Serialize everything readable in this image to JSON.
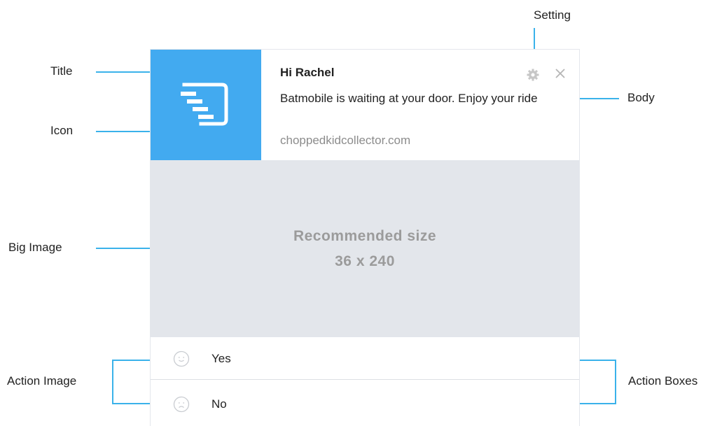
{
  "callouts": {
    "setting": "Setting",
    "title": "Title",
    "body": "Body",
    "icon": "Icon",
    "big_image": "Big Image",
    "action_image": "Action Image",
    "action_boxes": "Action Boxes"
  },
  "notification": {
    "title": "Hi Rachel",
    "body": "Batmobile is waiting at your door. Enjoy your ride",
    "origin": "choppedkidcollector.com",
    "big_image": {
      "line1": "Recommended size",
      "line2": "36 x 240"
    },
    "actions": [
      {
        "label": "Yes",
        "icon": "smile-face-icon"
      },
      {
        "label": "No",
        "icon": "sad-face-icon"
      }
    ],
    "icons": {
      "app": "app-logo-icon",
      "setting": "gear-icon",
      "close": "close-icon"
    }
  },
  "colors": {
    "icon_bg": "#42aaf0",
    "image_bg": "#e3e6eb",
    "callout_line": "#3ab2ea",
    "placeholder_text": "#9b9b9b"
  }
}
